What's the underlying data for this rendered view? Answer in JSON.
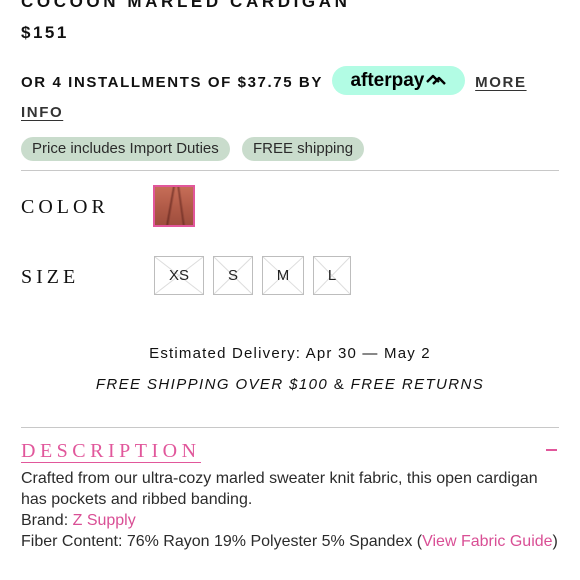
{
  "product": {
    "title": "COCOON MARLED CARDIGAN",
    "price": "$151"
  },
  "payment": {
    "installments_text": "OR 4 INSTALLMENTS OF $37.75 BY",
    "afterpay_label": "afterpay",
    "more_info": "MORE INFO"
  },
  "badges": [
    {
      "label": "Price includes Import Duties"
    },
    {
      "label": "FREE shipping"
    }
  ],
  "color": {
    "label": "COLOR",
    "selected_swatch": "rust marled"
  },
  "size": {
    "label": "SIZE",
    "options": [
      "XS",
      "S",
      "M",
      "L"
    ]
  },
  "delivery": {
    "estimated": "Estimated Delivery: Apr 30 — May 2",
    "free_shipping": "FREE SHIPPING OVER $100",
    "amp": "&",
    "free_returns": "FREE RETURNS"
  },
  "description": {
    "heading": "DESCRIPTION",
    "collapse_icon": "minus-icon",
    "text": "Crafted from our ultra-cozy marled sweater knit fabric, this open cardigan has pockets and ribbed banding.",
    "brand_label": "Brand:",
    "brand_value": "Z Supply",
    "fiber_label": "Fiber Content: 76% Rayon 19% Polyester 5% Spandex (",
    "fiber_link": "View Fabric Guide",
    "fiber_close": ")"
  },
  "colors": {
    "accent": "#e1579b",
    "afterpay_mint": "#b2fce4",
    "badge_green": "#c9dccc"
  }
}
